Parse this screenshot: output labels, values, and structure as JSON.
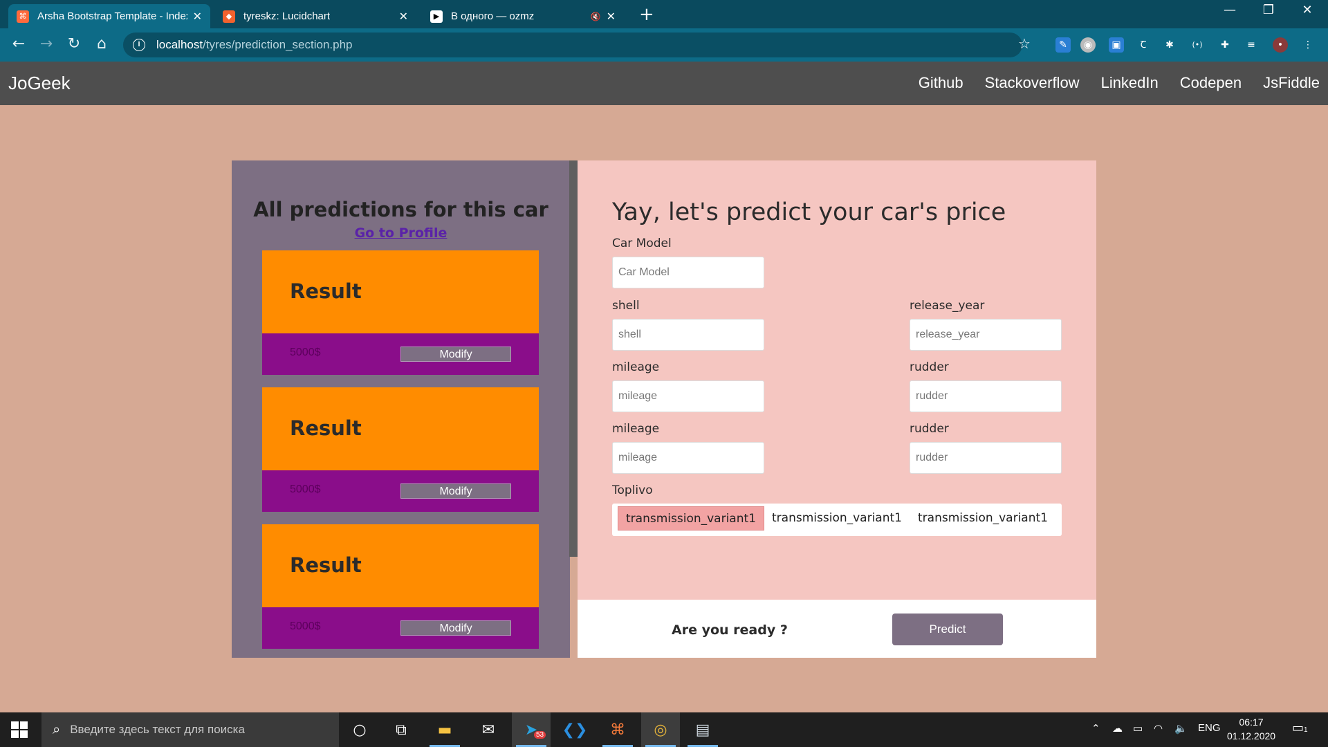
{
  "browser": {
    "tabs": [
      {
        "title": "Arsha Bootstrap Template - Index",
        "favicon_color": "#ff6a3d",
        "active": true
      },
      {
        "title": "tyreskz: Lucidchart",
        "favicon_color": "#f2622e",
        "active": false
      },
      {
        "title": "В одного — ozmz",
        "favicon_color": "#ffffff",
        "active": false
      }
    ],
    "url_host": "localhost",
    "url_path": "/tyres/prediction_section.php",
    "theme_color": "#0d6b87"
  },
  "site": {
    "brand": "JoGeek",
    "nav": [
      "Github",
      "Stackoverflow",
      "LinkedIn",
      "Codepen",
      "JsFiddle"
    ]
  },
  "predictions": {
    "title": "All predictions for this car",
    "profile_link": "Go to Profile",
    "cards": [
      {
        "label": "Result",
        "price": "5000$",
        "button": "Modify"
      },
      {
        "label": "Result",
        "price": "5000$",
        "button": "Modify"
      },
      {
        "label": "Result",
        "price": "5000$",
        "button": "Modify"
      }
    ],
    "card_color": "#ff8c00",
    "card_footer_color": "#8a0d8a"
  },
  "form": {
    "title": "Yay, let's predict your car's price",
    "car_model": {
      "label": "Car Model",
      "placeholder": "Car Model"
    },
    "shell": {
      "label": "shell",
      "placeholder": "shell"
    },
    "release_year": {
      "label": "release_year",
      "placeholder": "release_year"
    },
    "mileage1": {
      "label": "mileage",
      "placeholder": "mileage"
    },
    "rudder1": {
      "label": "rudder",
      "placeholder": "rudder"
    },
    "mileage2": {
      "label": "mileage",
      "placeholder": "mileage"
    },
    "rudder2": {
      "label": "rudder",
      "placeholder": "rudder"
    },
    "toplivo": {
      "label": "Toplivo",
      "options": [
        "transmission_variant1",
        "transmission_variant1",
        "transmission_variant1"
      ],
      "selected_index": 0
    },
    "ready_text": "Are you ready ?",
    "predict_button": "Predict"
  },
  "taskbar": {
    "search_placeholder": "Введите здесь текст для поиска",
    "telegram_badge": "53",
    "lang": "ENG",
    "time": "06:17",
    "date": "01.12.2020",
    "notif_count": "1"
  }
}
